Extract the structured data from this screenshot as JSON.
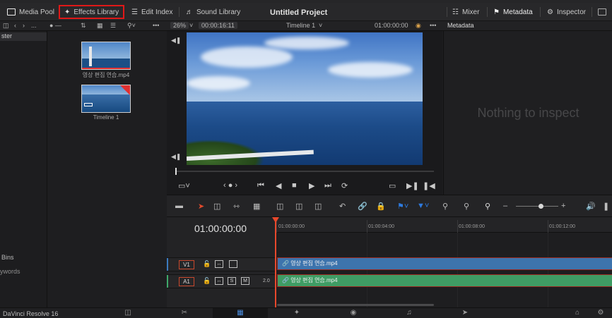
{
  "header": {
    "media_pool": "Media Pool",
    "effects_library": "Effects Library",
    "edit_index": "Edit Index",
    "sound_library": "Sound Library",
    "project_title": "Untitled Project",
    "mixer": "Mixer",
    "metadata": "Metadata",
    "inspector": "Inspector"
  },
  "bar2": {
    "ellipsis": "...",
    "zoom": "26%",
    "source_timecode": "00:00:16:11",
    "timeline_name": "Timeline 1",
    "record_timecode": "01:00:00:00",
    "more": "•••",
    "panel_title": "Metadata"
  },
  "bins": {
    "master": "ster",
    "smart_bins": "Bins",
    "keywords": "ywords"
  },
  "media_pool": {
    "clip_name": "영상 편집 연습.mp4",
    "timeline_name": "Timeline 1"
  },
  "inspector": {
    "empty_message": "Nothing to inspect"
  },
  "timeline": {
    "timecode": "01:00:00:00",
    "ruler": [
      "01:00:00:00",
      "01:00:04:00",
      "01:00:08:00",
      "01:00:12:00"
    ],
    "video_track": "V1",
    "audio_track": "A1",
    "audio_channels": "2.0",
    "video_clip": "영상 편집 연습.mp4",
    "audio_clip": "영상 편집 연습.mp4",
    "solo": "S",
    "mute": "M"
  },
  "footer": {
    "app_name": "DaVinci Resolve 16"
  },
  "colors": {
    "highlight": "#e01818",
    "timeline_name": "#e24a2c",
    "video_clip": "#3d74ad",
    "audio_clip": "#3f9c64"
  }
}
